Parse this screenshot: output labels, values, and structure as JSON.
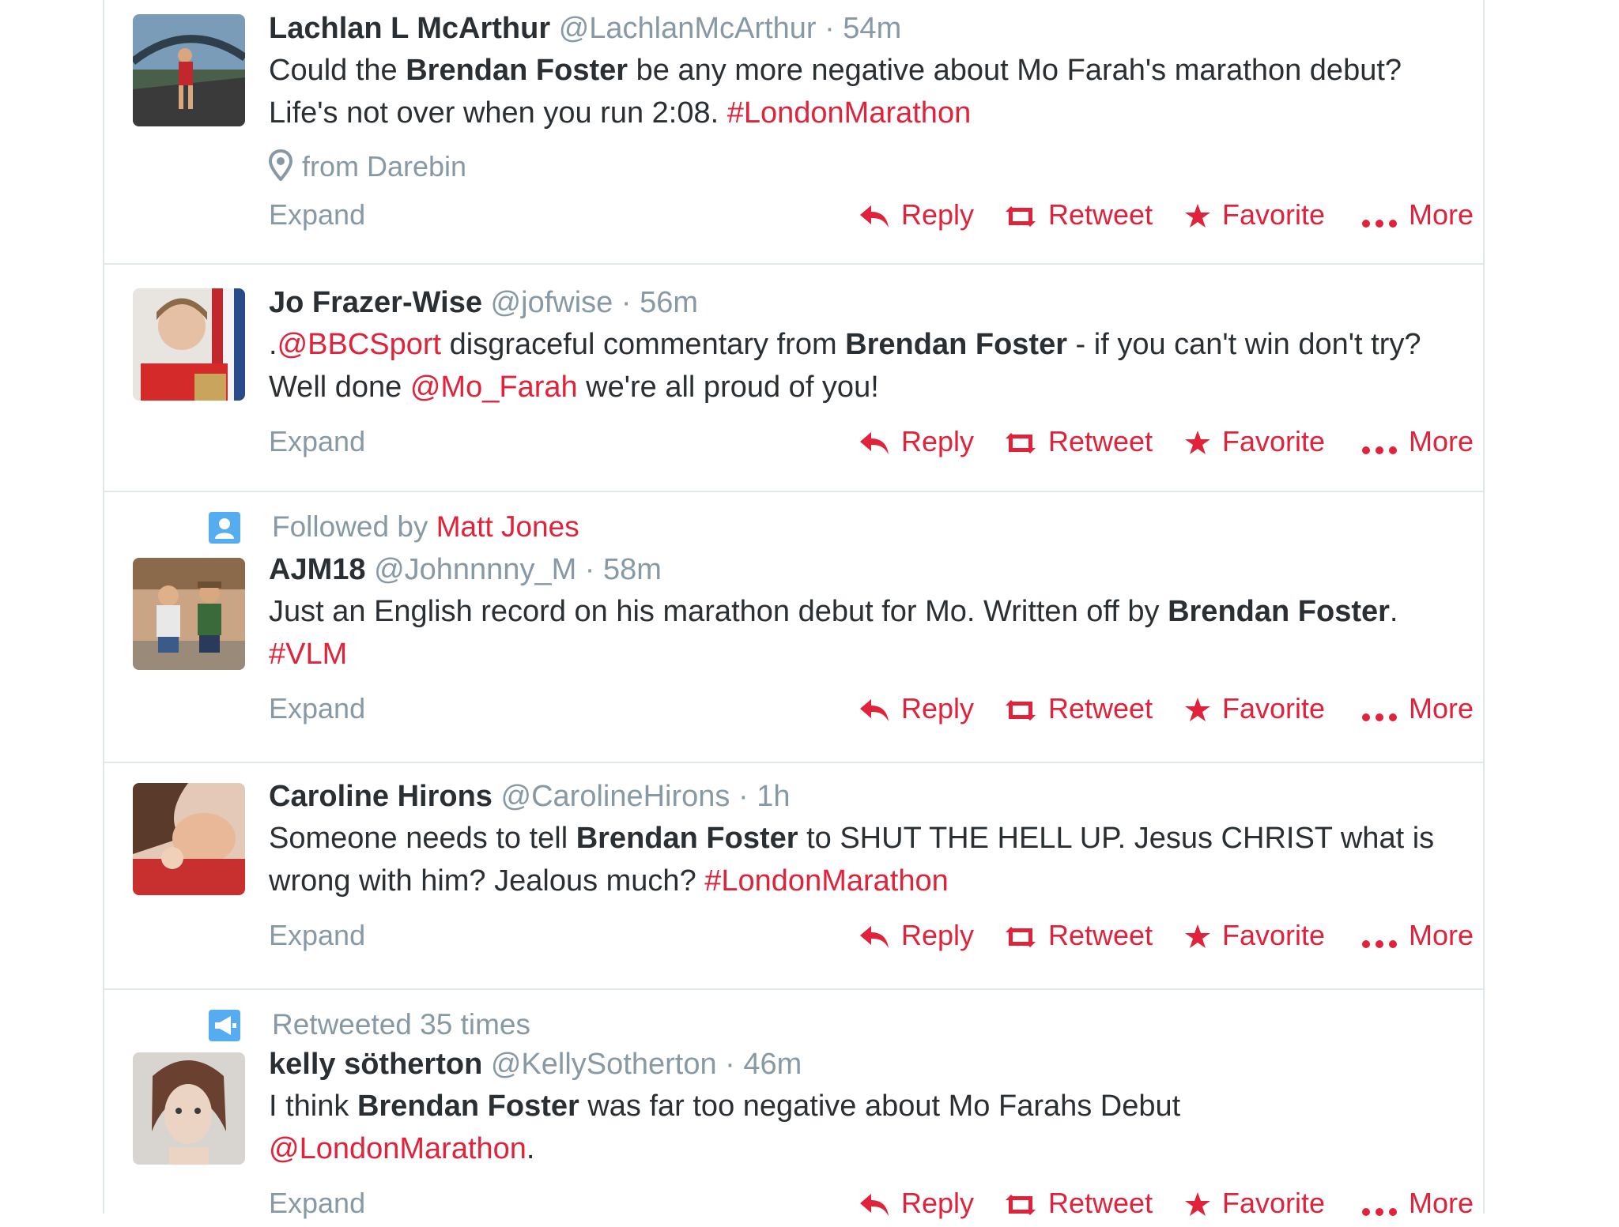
{
  "actions": {
    "expand": "Expand",
    "reply": "Reply",
    "retweet": "Retweet",
    "favorite": "Favorite",
    "more": "More"
  },
  "colors": {
    "link": "#e0223a",
    "muted": "#8899a6",
    "text": "#292f33",
    "badge": "#55acee"
  },
  "tweets": [
    {
      "name": "Lachlan L McArthur",
      "handle": "@LachlanMcArthur",
      "sep": "·",
      "time": "54m",
      "text": [
        "Could the ",
        "Brendan Foster",
        " be any more negative about Mo Farah's marathon debut? Life's not over when you run 2:08. ",
        "#LondonMarathon"
      ],
      "location": "from Darebin"
    },
    {
      "name": "Jo Frazer-Wise",
      "handle": "@jofwise",
      "sep": "·",
      "time": "56m",
      "text": [
        ".",
        "@BBCSport",
        " disgraceful commentary from ",
        "Brendan Foster",
        " - if you can't win don't try? Well done ",
        "@Mo_Farah",
        " we're all proud of you!"
      ]
    },
    {
      "context_prefix": "Followed by",
      "context_link": "Matt Jones",
      "context_icon": "person-icon",
      "name": "AJM18",
      "handle": "@Johnnnny_M",
      "sep": "·",
      "time": "58m",
      "text": [
        "Just an English record on his marathon debut for Mo. Written off by ",
        "Brendan Foster",
        ". ",
        "#VLM"
      ]
    },
    {
      "name": "Caroline Hirons",
      "handle": "@CarolineHirons",
      "sep": "·",
      "time": "1h",
      "text": [
        "Someone needs to tell ",
        "Brendan Foster",
        " to SHUT THE HELL UP. Jesus CHRIST what is wrong with him? Jealous much? ",
        "#LondonMarathon"
      ]
    },
    {
      "context_prefix": "Retweeted 35 times",
      "context_icon": "megaphone-icon",
      "name": "kelly sötherton",
      "handle": "@KellySotherton",
      "sep": "·",
      "time": "46m",
      "text": [
        "I think ",
        "Brendan Foster",
        " was far too negative about Mo Farahs Debut ",
        "@LondonMarathon",
        "."
      ]
    }
  ]
}
